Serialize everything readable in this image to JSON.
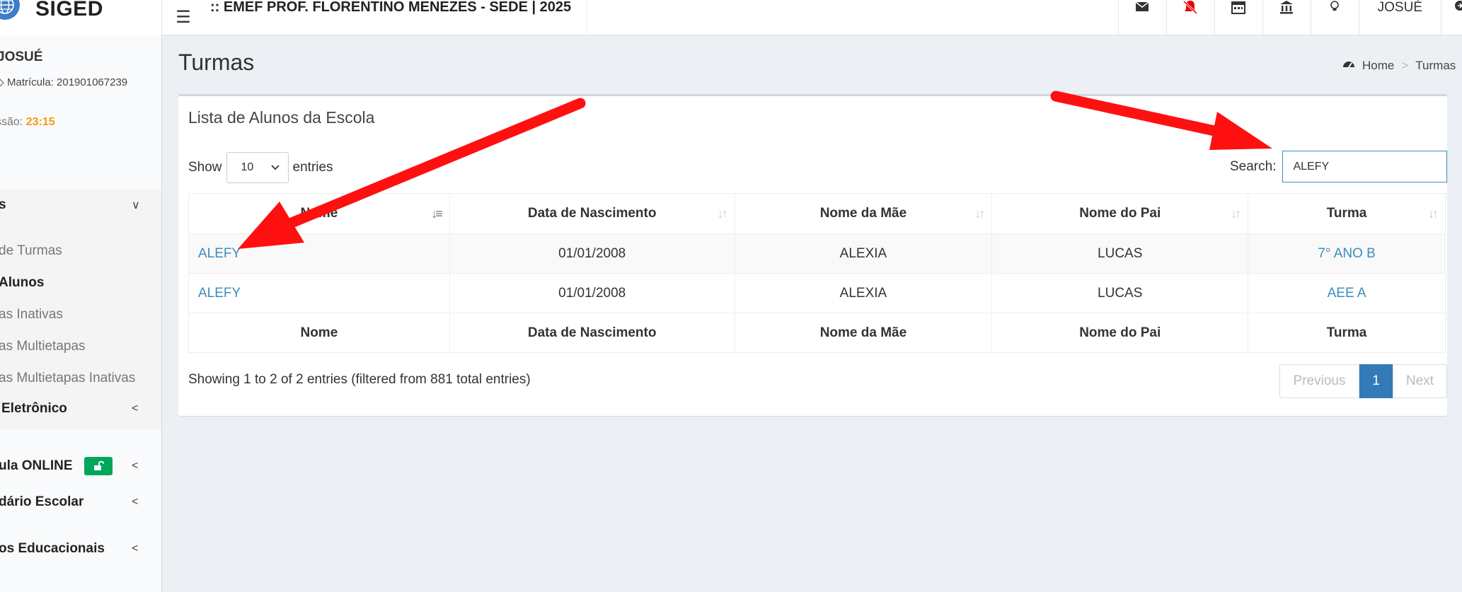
{
  "header": {
    "logo": "SIGED",
    "school": ":: EMEF PROF. FLORENTINO MENEZES - SEDE | 2025",
    "user": "JOSUÉ",
    "icons": [
      "envelope-icon",
      "bell-slash-icon",
      "calendar-icon",
      "bank-icon",
      "lightbulb-icon",
      "sign-out-icon"
    ]
  },
  "sidebar": {
    "user_name": "JOSUÉ",
    "matricula": "Matrícula: 201901067239",
    "sessao_label": "ssão: ",
    "sessao_time": "23:15",
    "menu_open": "s",
    "submenu": [
      "de Turmas",
      "Alunos",
      "as Inativas",
      "as Multietapas",
      "as Multietapas Inativas"
    ],
    "menu_items": [
      "Eletrônico",
      "ula ONLINE",
      "dário Escolar",
      "os Educacionais"
    ]
  },
  "content": {
    "title": "Turmas",
    "breadcrumb": {
      "home": "Home",
      "current": "Turmas"
    },
    "box_title": "Lista de Alunos da Escola",
    "show_label": "Show",
    "show_value": "10",
    "entries_label": "entries",
    "search_label": "Search:",
    "search_value": "ALEFY",
    "columns": [
      "Nome",
      "Data de Nascimento",
      "Nome da Mãe",
      "Nome do Pai",
      "Turma"
    ],
    "rows": [
      {
        "nome": "ALEFY",
        "nasc": "01/01/2008",
        "mae": "ALEXIA",
        "pai": "LUCAS",
        "turma": "7° ANO B"
      },
      {
        "nome": "ALEFY",
        "nasc": "01/01/2008",
        "mae": "ALEXIA",
        "pai": "LUCAS",
        "turma": "AEE A"
      }
    ],
    "info": "Showing 1 to 2 of 2 entries (filtered from 881 total entries)",
    "pager": {
      "prev": "Previous",
      "current": "1",
      "next": "Next"
    }
  },
  "colors": {
    "link": "#3c8dbc",
    "accent": "#337ab7",
    "timer": "#f39c12",
    "badge": "#00a65a",
    "arrow": "#ff1010"
  }
}
